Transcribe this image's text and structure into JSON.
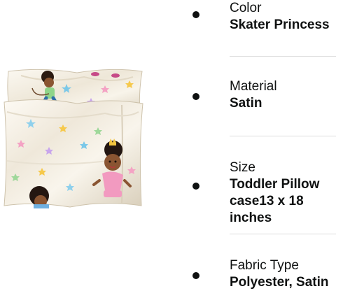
{
  "product": {
    "image_alt": "Skater Princess satin toddler pillowcases"
  },
  "attributes": [
    {
      "label": "Color",
      "value": "Skater Princess"
    },
    {
      "label": "Material",
      "value": "Satin"
    },
    {
      "label": "Size",
      "value": "Toddler Pillow case13 x 18 inches"
    },
    {
      "label": "Fabric Type",
      "value": "Polyester, Satin"
    }
  ],
  "colors": {
    "text": "#0f1111",
    "divider": "#dddddd",
    "pillow_satin": "#f1ece0"
  }
}
